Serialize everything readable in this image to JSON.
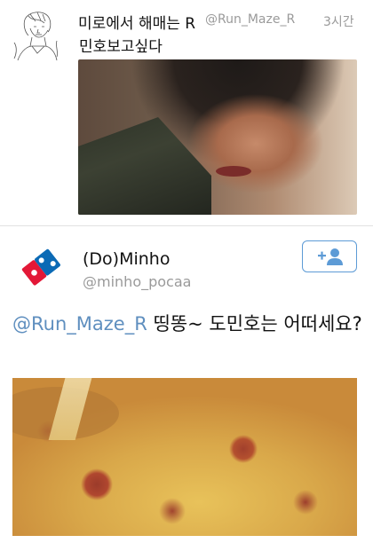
{
  "tweet1": {
    "display_name": "미로에서 해매는 R",
    "handle": "@Run_Maze_R",
    "time": "3시간",
    "text": "민호보고싶다"
  },
  "tweet2": {
    "display_name": "(Do)Minho",
    "handle": "@minho_pocaa",
    "mention": "@Run_Maze_R",
    "text": " 띵똥~ 도민호는 어떠세요?",
    "follow_icon": "add-user-icon"
  },
  "colors": {
    "link": "#5f8fbf",
    "follow_border": "#5d9bd6",
    "secondary_text": "#9a9a9a",
    "domino_red": "#e31837",
    "domino_blue": "#0b6ab5"
  }
}
